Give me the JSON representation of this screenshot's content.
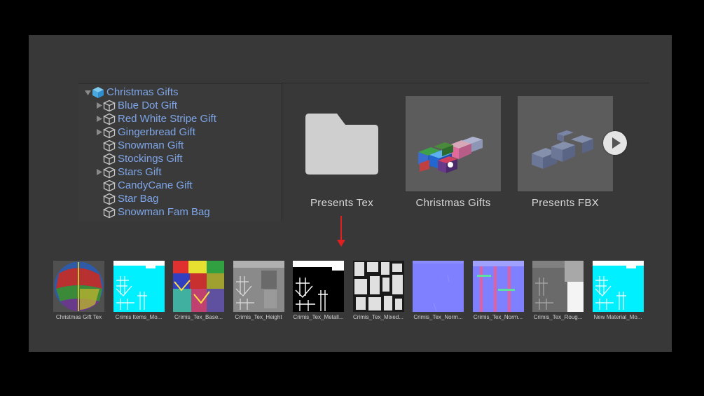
{
  "hierarchy": {
    "root": "Christmas Gifts",
    "items": [
      {
        "label": "Blue Dot Gift",
        "expandable": true
      },
      {
        "label": "Red White Stripe Gift",
        "expandable": true
      },
      {
        "label": "Gingerbread Gift",
        "expandable": true
      },
      {
        "label": "Snowman Gift",
        "expandable": false
      },
      {
        "label": "Stockings Gift",
        "expandable": false
      },
      {
        "label": "Stars Gift",
        "expandable": true
      },
      {
        "label": "CandyCane Gift",
        "expandable": false
      },
      {
        "label": "Star Bag",
        "expandable": false
      },
      {
        "label": "Snowman Fam Bag",
        "expandable": false
      }
    ]
  },
  "assets": [
    {
      "label": "Presents Tex",
      "type": "folder"
    },
    {
      "label": "Christmas Gifts",
      "type": "prefab"
    },
    {
      "label": "Presents FBX",
      "type": "model"
    }
  ],
  "textures": [
    {
      "label": "Christmas Gift Tex"
    },
    {
      "label": "Crimis Items_Mo..."
    },
    {
      "label": "Crimis_Tex_Base..."
    },
    {
      "label": "Crimis_Tex_Height"
    },
    {
      "label": "Crimis_Tex_Metall..."
    },
    {
      "label": "Crimis_Tex_Mixed..."
    },
    {
      "label": "Crimis_Tex_Norm..."
    },
    {
      "label": "Crimis_Tex_Norm..."
    },
    {
      "label": "Crimis_Tex_Roug..."
    },
    {
      "label": "New Material_Mo..."
    }
  ],
  "colors": {
    "accent_text": "#7ea5e8",
    "arrow": "#e02020",
    "cyan": "#00f0ff",
    "normal_map": "#7f80ff"
  }
}
